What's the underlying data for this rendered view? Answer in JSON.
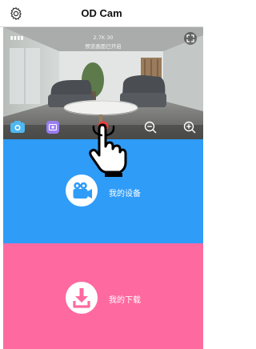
{
  "header": {
    "title": "OD Cam",
    "settings_icon": "gear-icon"
  },
  "preview": {
    "battery": "▮▮▮▮",
    "resolution": "2.7K 30",
    "status_text": "预览画面已开启",
    "controls": [
      "camera-switch-icon",
      "record-mode-icon",
      "shutter-button",
      "zoom-out-icon",
      "zoom-in-icon"
    ],
    "fullscreen_icon": "fullscreen-icon"
  },
  "menu": {
    "my_devices": {
      "label": "我的设备",
      "icon": "video-camera-icon",
      "color": "#2f9cf8"
    },
    "my_downloads": {
      "label": "我的下载",
      "icon": "download-icon",
      "color": "#fe6aa0"
    }
  },
  "colors": {
    "shutter": "#ee3b3b",
    "control_icon": "#4fb8f0",
    "record_icon": "#9b7df2"
  }
}
